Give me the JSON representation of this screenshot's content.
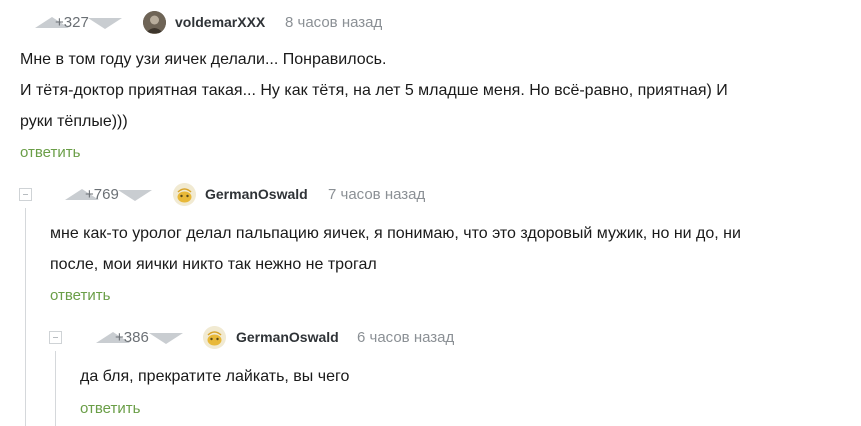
{
  "comments": [
    {
      "rating": "+327",
      "username": "voldemarXXX",
      "time": "8 часов назад",
      "lines": [
        "Мне в том году узи яичек делали... Понравилось.",
        "И тётя-доктор приятная такая... Ну как тётя, на лет 5 младше меня. Но всё-равно, приятная) И",
        "руки тёплые)))"
      ],
      "reply_label": "ответить"
    },
    {
      "rating": "+769",
      "username": "GermanOswald",
      "time": "7 часов назад",
      "lines": [
        "мне как-то уролог делал пальпацию яичек, я понимаю, что это здоровый мужик, но ни до, ни",
        "после, мои яички никто так нежно не трогал"
      ],
      "reply_label": "ответить"
    },
    {
      "rating": "+386",
      "username": "GermanOswald",
      "time": "6 часов назад",
      "lines": [
        "да бля, прекратите лайкать, вы чего"
      ],
      "reply_label": "ответить"
    }
  ]
}
